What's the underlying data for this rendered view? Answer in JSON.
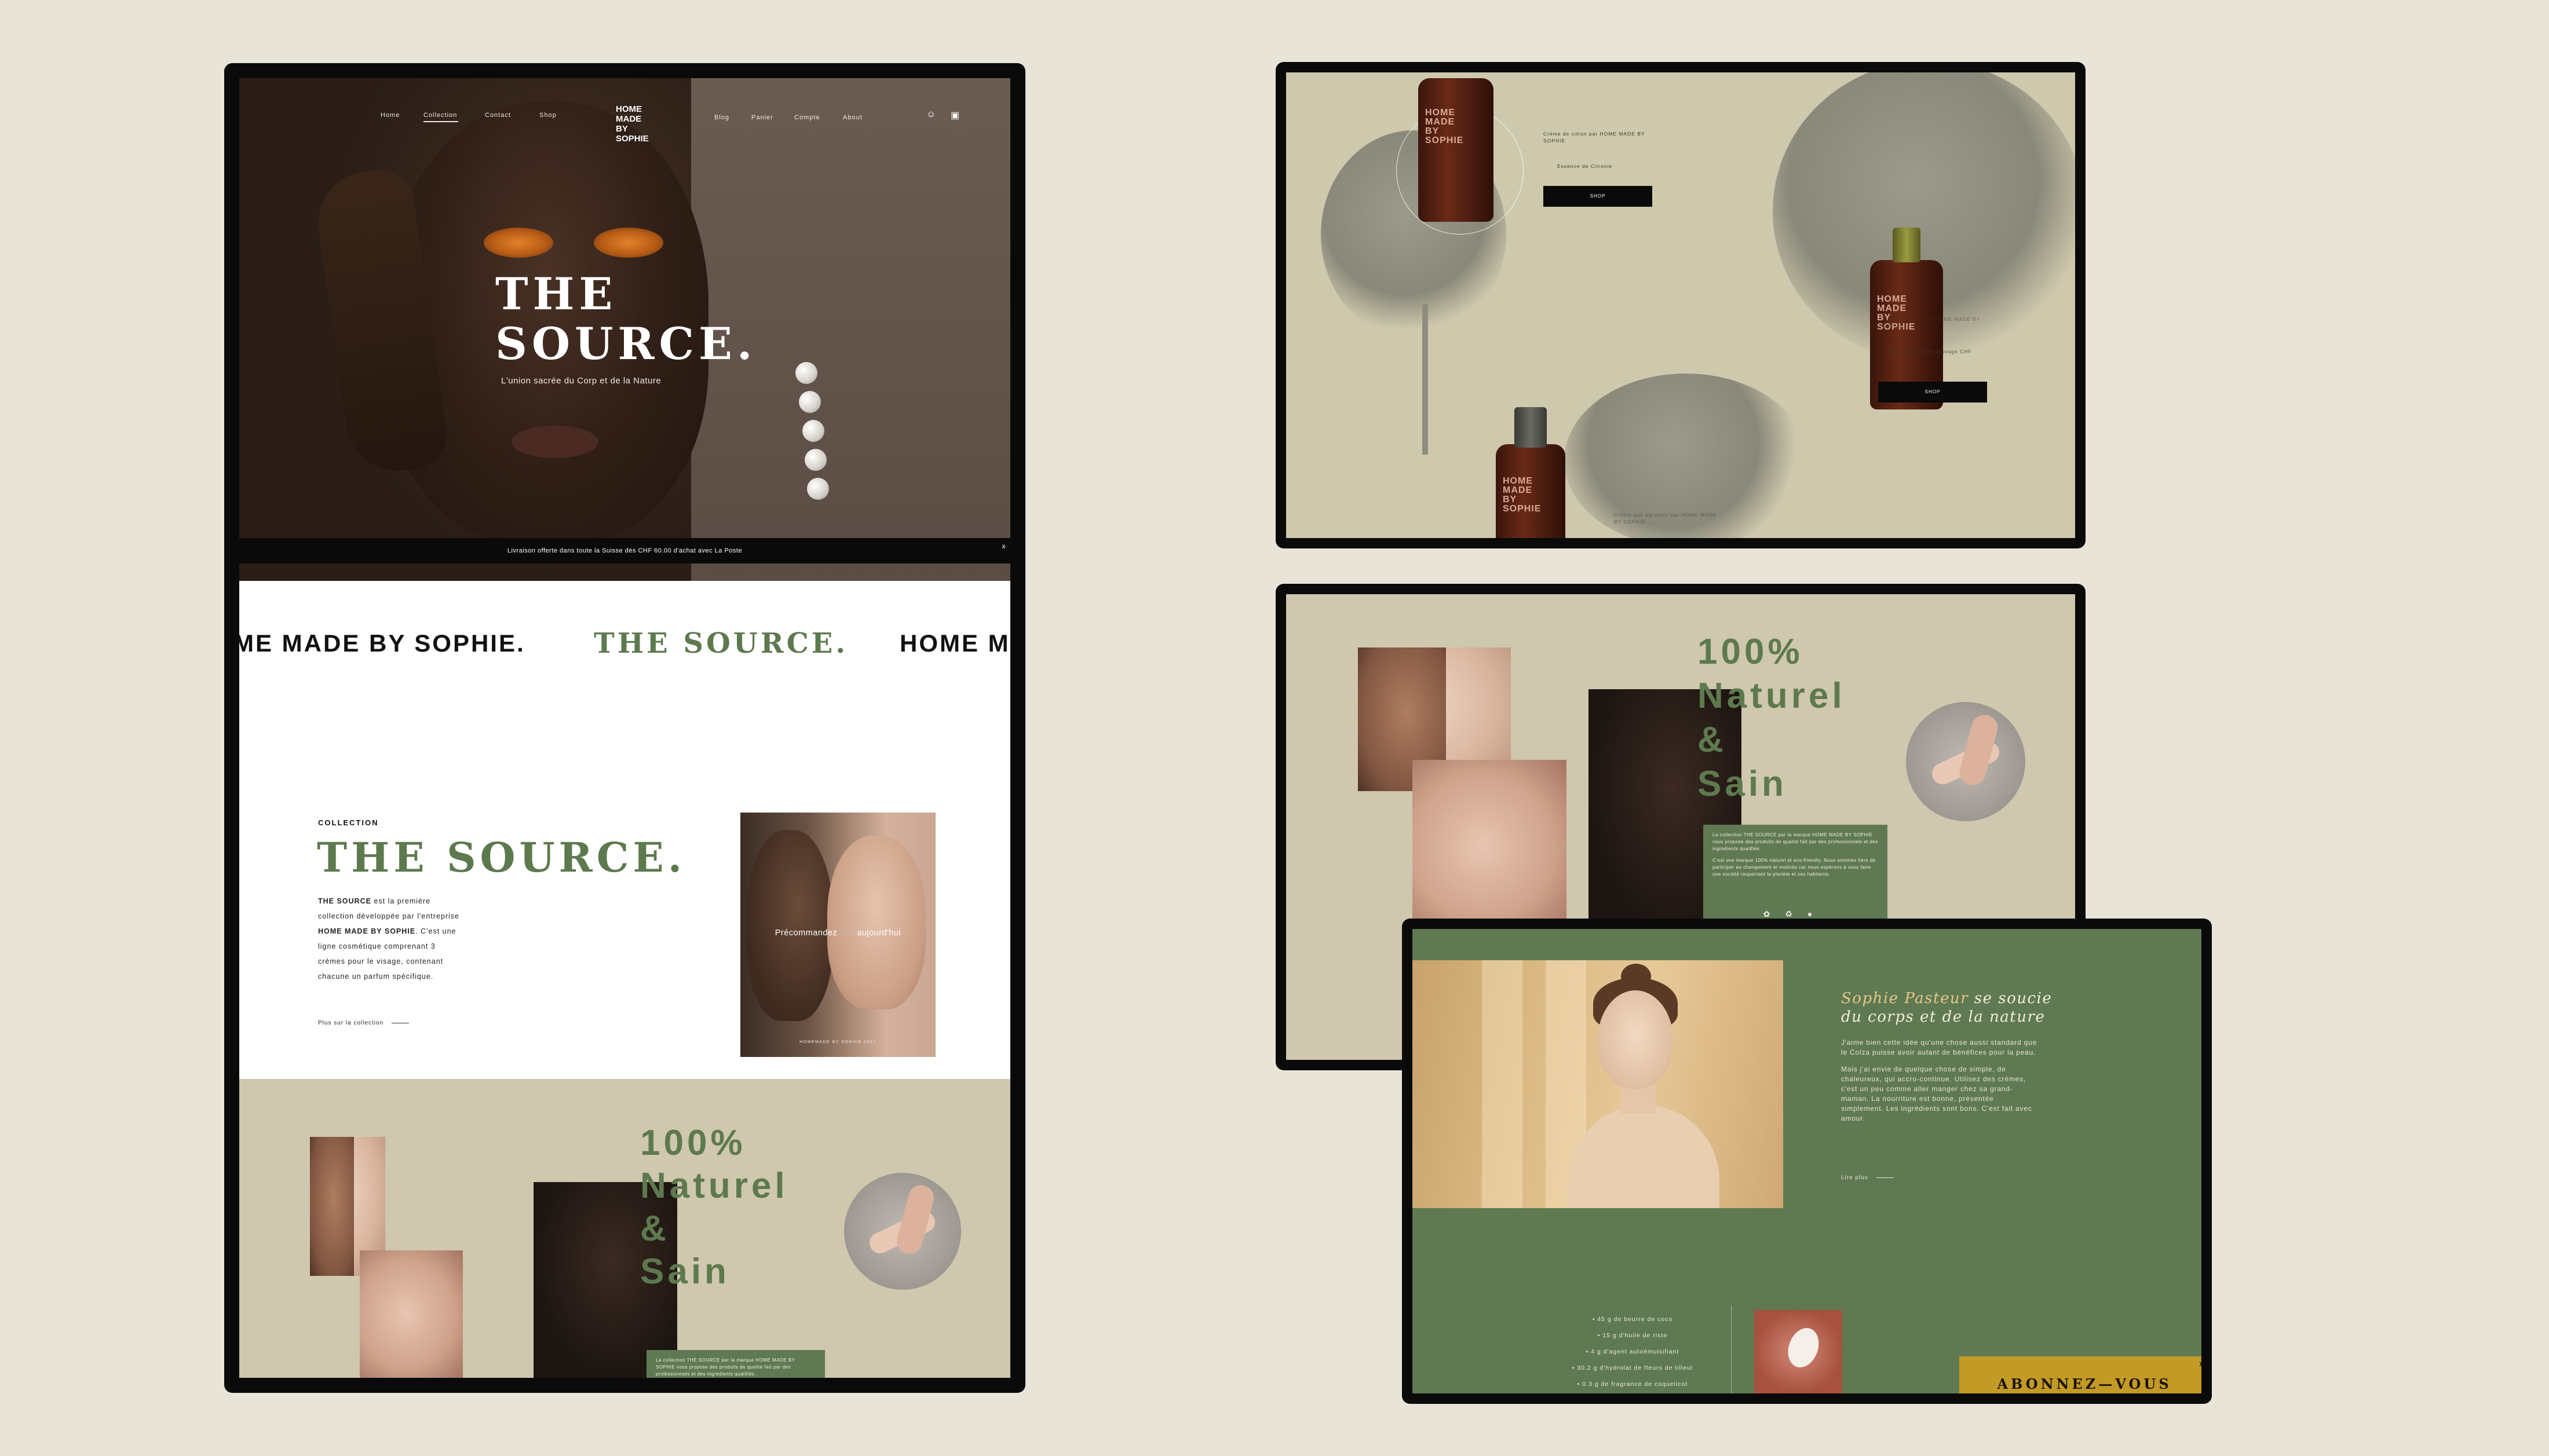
{
  "brand": {
    "logo_lines": [
      "HOME",
      "MADE",
      "BY",
      "SOPHIE"
    ],
    "colors": {
      "background": "#e9e4d8",
      "green": "#5d7a4e",
      "sand": "#cfc7ae",
      "gold": "#c39a26"
    }
  },
  "desktop": {
    "nav": {
      "left": [
        "Home",
        "Collection",
        "Contact",
        "Shop"
      ],
      "right": [
        "Blog",
        "Panier",
        "Compte",
        "About"
      ],
      "icons": [
        "user-icon",
        "cart-icon"
      ]
    },
    "hero": {
      "title_line1": "THE",
      "title_line2": "SOURCE.",
      "subtitle": "L'union sacrée du Corp et de la Nature"
    },
    "promo": {
      "text": "Livraison offerte dans toute la Suisse dès CHF 60.00 d'achat avec La Poste",
      "close": "x"
    },
    "marquee": {
      "item1": "ME MADE BY SOPHIE.",
      "item2": "THE SOURCE.",
      "item3": "HOME M"
    },
    "collection": {
      "label": "COLLECTION",
      "title": "THE SOURCE.",
      "text_parts": {
        "brand": "THE SOURCE",
        "p1": " est la première collection développée par l'entreprise ",
        "company": "HOME MADE BY SOPHIE",
        "p2": ". C'est une ligne cosmétique comprenant 3 crèmes pour le visage, contenant chacune un parfum spécifique."
      },
      "link": "Plus sur la collection",
      "photo_text_a": "Précommandez",
      "photo_text_dim": "dès",
      "photo_text_b": "aujourd'hui",
      "photo_caption": "HOMEMADE BY SOPHIE 2021"
    },
    "natural": {
      "title_lines": [
        "100%",
        "Naturel",
        "&",
        "Sain"
      ],
      "box_p1": "La collection THE SOURCE par la marque HOME MADE BY SOPHIE vous propose des produits de qualité fait par des professionnels et des ingrédients qualifiés.",
      "box_p2": "C'est une marque 100% naturel et eco-friendly. Nous sommes fiers de participer au changement et motivés car nous espérons à vous faire une société respectant la planète et ses habitants.",
      "icons": [
        "leaf-icon",
        "recycle-icon",
        "drop-icon"
      ]
    }
  },
  "products": {
    "items": [
      {
        "title": "Crème de citron par HOME MADE BY SOPHIE",
        "desc": "Essence de Citronie",
        "button": "SHOP"
      },
      {
        "title": "Crème au miel par HOME MADE BY SOPHIE",
        "desc": "Essence de miel sauvage CHF",
        "button": "SHOP"
      },
      {
        "title": "Crème aux agrumes par HOME MADE BY SOPHIE",
        "desc": "",
        "button": ""
      }
    ],
    "bottle_label": [
      "HOME",
      "MADE",
      "BY",
      "SOPHIE"
    ]
  },
  "sophie": {
    "title_name": "Sophie Pasteur",
    "title_rest1": " se soucie",
    "title_line2": "du corps et de la nature",
    "p1": "J'aime bien cette idée qu'une chose aussi standard que le Colza puisse avoir autant de bénéfices pour la peau.",
    "p2": "Mais j'ai envie de quelque chose de simple, de chaleureux, qui accro-continue. Utilisez des crèmes, c'est un peu comme aller manger chez sa grand-maman. La nourriture est bonne, présentée simplement. Les ingrédients sont bons. C'est fait avec amour.",
    "more": "Lire plus",
    "ingredients": [
      "• 45 g de beurre de coco",
      "• 15 g d'huile de riste",
      "• 4 g d'agent autoémulsifiant",
      "• 30.2 g d'hydrolat de fleurs de tilleul",
      "• 0.3 g de fragrance de coquelicot"
    ],
    "subscribe": "ABONNEZ—VOUS",
    "subscribe_close": "x"
  }
}
